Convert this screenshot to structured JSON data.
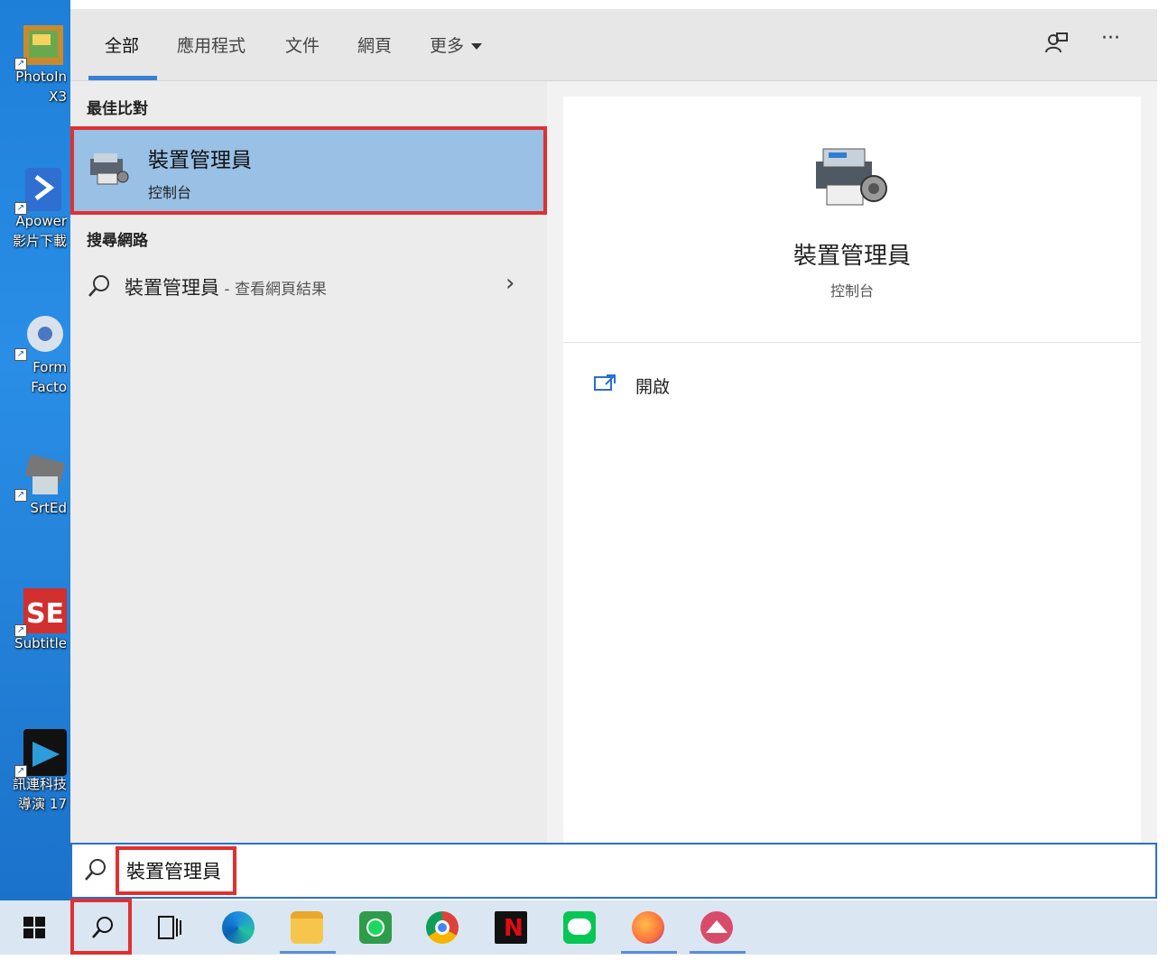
{
  "desktop": {
    "icons": [
      {
        "label1": "PhotoIn",
        "label2": "X3"
      },
      {
        "label1": "Apower",
        "label2": "影片下載"
      },
      {
        "label1": "Form",
        "label2": "Facto"
      },
      {
        "label1": "SrtEd",
        "label2": ""
      },
      {
        "label1": "Subtitle",
        "label2": ""
      },
      {
        "label1": "訊連科技",
        "label2": "導演 17"
      }
    ]
  },
  "tabs": {
    "all": "全部",
    "apps": "應用程式",
    "documents": "文件",
    "web": "網頁",
    "more": "更多"
  },
  "toolbar": {
    "more_options": "···"
  },
  "best_match": {
    "section_title": "最佳比對",
    "name": "裝置管理員",
    "subtitle": "控制台"
  },
  "web_search": {
    "section_title": "搜尋網路",
    "query": "裝置管理員",
    "suffix": " - 查看網頁結果"
  },
  "preview": {
    "title": "裝置管理員",
    "subtitle": "控制台",
    "action_open": "開啟"
  },
  "searchbox": {
    "value": "裝置管理員"
  },
  "taskbar": {
    "apps": [
      "windows-start",
      "search",
      "task-view",
      "edge",
      "file-explorer",
      "spotify",
      "chrome",
      "netflix",
      "line",
      "firefox",
      "mvp"
    ]
  }
}
